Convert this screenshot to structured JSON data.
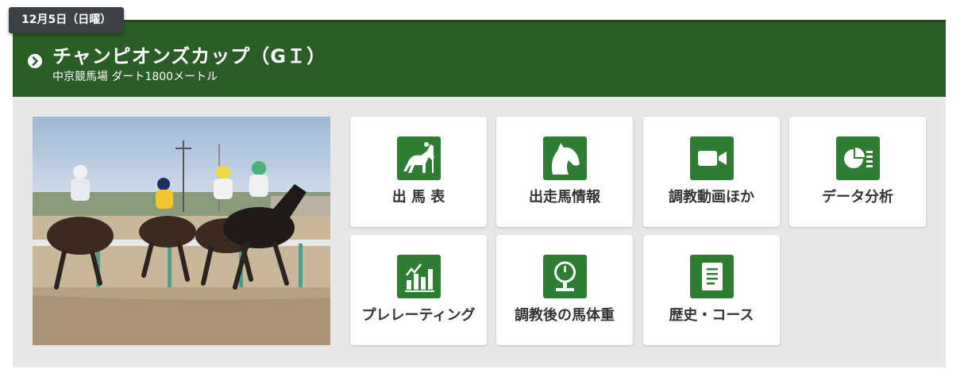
{
  "date_badge": "12月5日（日曜）",
  "race": {
    "title": "チャンピオンズカップ（GＩ）",
    "subtitle": "中京競馬場 ダート1800メートル"
  },
  "colors": {
    "header_bg": "#2a5e26",
    "icon_bg": "#2e7d32",
    "badge_bg": "#3d4045",
    "panel_bg": "#e8e8e8"
  },
  "photo": {
    "icon": "horse-race-photo"
  },
  "menu": [
    {
      "label": "出 馬 表",
      "icon": "horse-jockey-icon"
    },
    {
      "label": "出走馬情報",
      "icon": "horse-head-icon"
    },
    {
      "label": "調教動画ほか",
      "icon": "video-camera-icon"
    },
    {
      "label": "データ分析",
      "icon": "pie-chart-icon"
    },
    {
      "label": "プレレーティング",
      "icon": "bar-chart-icon"
    },
    {
      "label": "調教後の馬体重",
      "icon": "scale-icon"
    },
    {
      "label": "歴史・コース",
      "icon": "document-icon"
    }
  ]
}
